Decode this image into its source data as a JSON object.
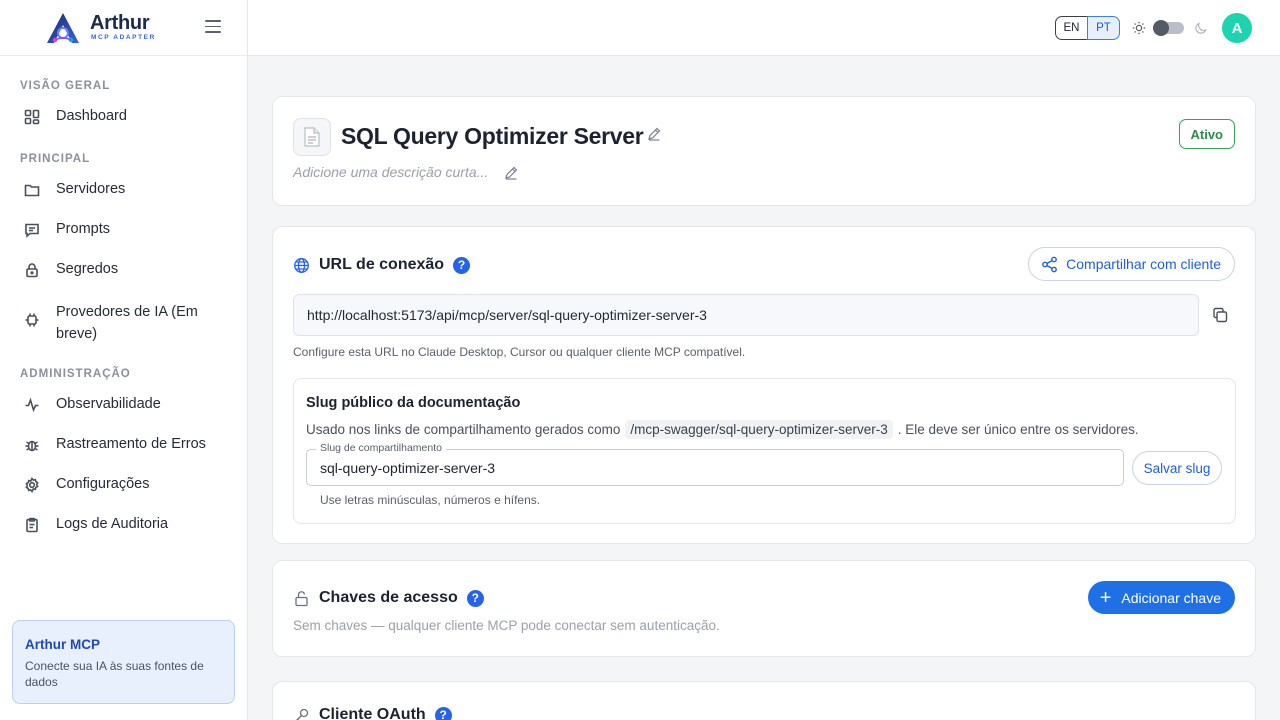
{
  "brand": {
    "name": "Arthur",
    "subtitle": "MCP ADAPTER"
  },
  "sidebar": {
    "sections": [
      {
        "title": "VISÃO GERAL",
        "items": [
          {
            "label": "Dashboard",
            "icon": "grid-icon"
          }
        ]
      },
      {
        "title": "PRINCIPAL",
        "items": [
          {
            "label": "Servidores",
            "icon": "folder-icon"
          },
          {
            "label": "Prompts",
            "icon": "message-icon"
          },
          {
            "label": "Segredos",
            "icon": "lock-icon"
          },
          {
            "label": "Provedores de IA (Em breve)",
            "icon": "chip-icon"
          }
        ]
      },
      {
        "title": "ADMINISTRAÇÃO",
        "items": [
          {
            "label": "Observabilidade",
            "icon": "activity-icon"
          },
          {
            "label": "Rastreamento de Erros",
            "icon": "bug-icon"
          },
          {
            "label": "Configurações",
            "icon": "gear-icon"
          },
          {
            "label": "Logs de Auditoria",
            "icon": "clipboard-icon"
          }
        ]
      }
    ],
    "promo": {
      "title": "Arthur MCP",
      "text": "Conecte sua IA às suas fontes de dados"
    }
  },
  "topbar": {
    "lang_en": "EN",
    "lang_pt": "PT",
    "selected_lang": "PT",
    "avatar": "A"
  },
  "server": {
    "title": "SQL Query Optimizer Server",
    "description_placeholder": "Adicione uma descrição curta...",
    "status": "Ativo",
    "status_color": "#2e8a4a"
  },
  "connection": {
    "title": "URL de conexão",
    "help": "?",
    "share_label": "Compartilhar com cliente",
    "url": "http://localhost:5173/api/mcp/server/sql-query-optimizer-server-3",
    "hint": "Configure esta URL no Claude Desktop, Cursor ou qualquer cliente MCP compatível.",
    "slug": {
      "title": "Slug público da documentação",
      "desc_before": "Usado nos links de compartilhamento gerados como",
      "desc_code": "/mcp-swagger/sql-query-optimizer-server-3",
      "desc_after": ". Ele deve ser único entre os servidores.",
      "field_label": "Slug de compartilhamento",
      "field_value": "sql-query-optimizer-server-3",
      "save_label": "Salvar slug",
      "hint": "Use letras minúsculas, números e hífens."
    }
  },
  "access_keys": {
    "title": "Chaves de acesso",
    "help": "?",
    "add_label": "Adicionar chave",
    "empty_text": "Sem chaves — qualquer cliente MCP pode conectar sem autenticação."
  },
  "oauth": {
    "title": "Cliente OAuth",
    "help": "?"
  },
  "colors": {
    "accent": "#1f6fe5",
    "avatar": "#1dd3b0",
    "promo_bg": "#e9f0fd"
  }
}
